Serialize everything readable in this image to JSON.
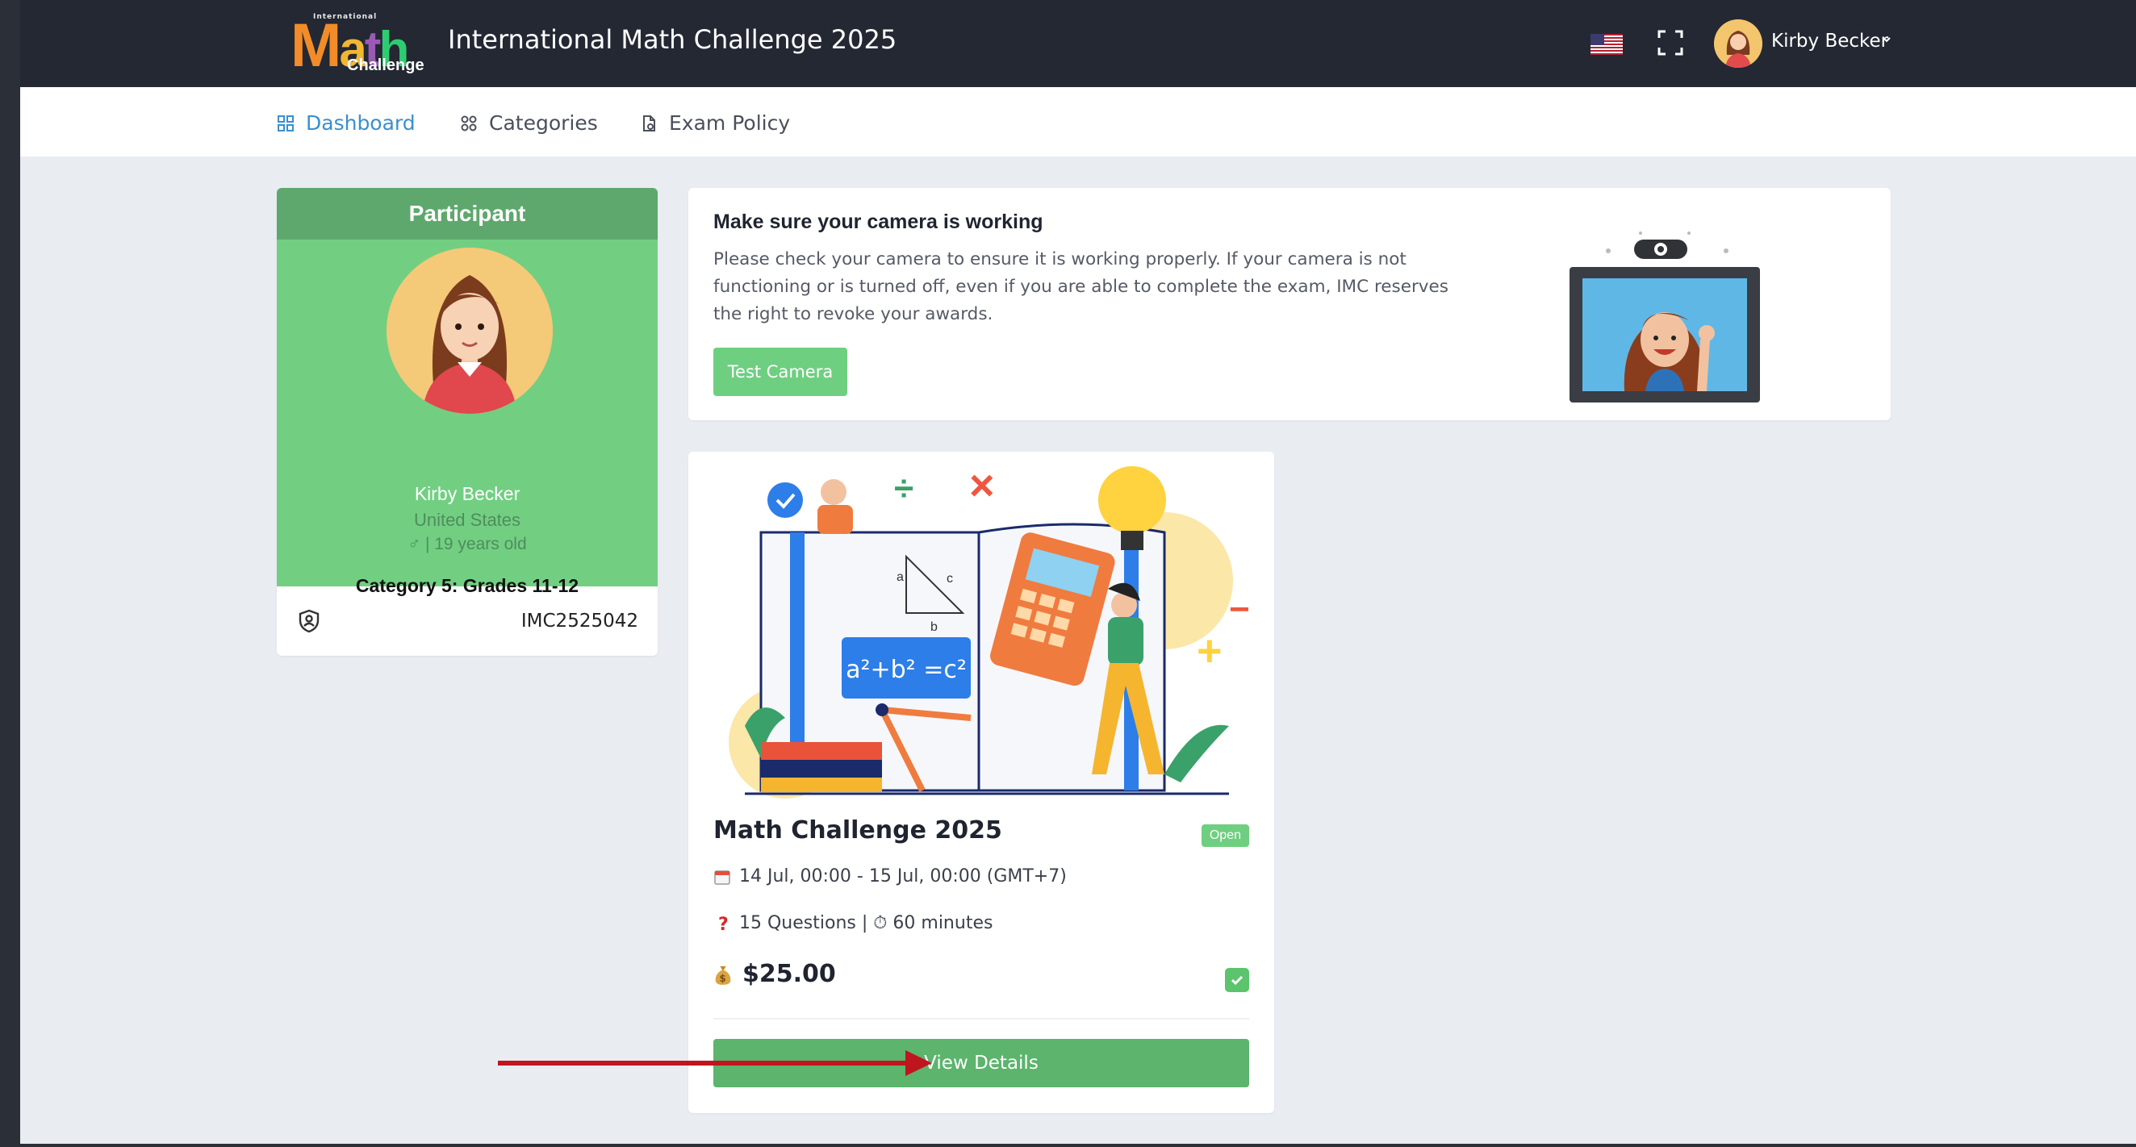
{
  "header": {
    "logo": {
      "tiny": "International",
      "letters": [
        "M",
        "a",
        "t",
        "h"
      ],
      "sub": "Challenge"
    },
    "title": "International Math Challenge 2025",
    "language_icon": "us-flag-icon",
    "fullscreen_icon": "fullscreen-icon",
    "user_name": "Kirby Becker"
  },
  "nav": {
    "items": [
      {
        "label": "Dashboard",
        "icon": "dashboard-icon",
        "active": true
      },
      {
        "label": "Categories",
        "icon": "categories-icon",
        "active": false
      },
      {
        "label": "Exam Policy",
        "icon": "document-icon",
        "active": false
      }
    ]
  },
  "participant": {
    "heading": "Participant",
    "name": "Kirby Becker",
    "country": "United States",
    "meta": "♂ | 19 years old",
    "category": "Category 5: Grades 11-12",
    "id": "IMC2525042"
  },
  "camera": {
    "title": "Make sure your camera is working",
    "text": "Please check your camera to ensure it is working properly. If your camera is not functioning or is turned off, even if you are able to complete the exam, IMC reserves the right to revoke your awards.",
    "button": "Test Camera"
  },
  "exam": {
    "illustration_formula": "a²+b² =c²",
    "illustration_labels": [
      "a",
      "b",
      "c"
    ],
    "title": "Math Challenge 2025",
    "status": "Open",
    "schedule": "14 Jul, 00:00 - 15 Jul, 00:00 (GMT+7)",
    "details": "15 Questions | ⏱ 60 minutes",
    "price": "$25.00",
    "button": "View Details"
  },
  "colors": {
    "topbar": "#232833",
    "accent_green": "#5cb46d",
    "active_nav": "#3a8fce",
    "arrow_red": "#c0151f"
  }
}
